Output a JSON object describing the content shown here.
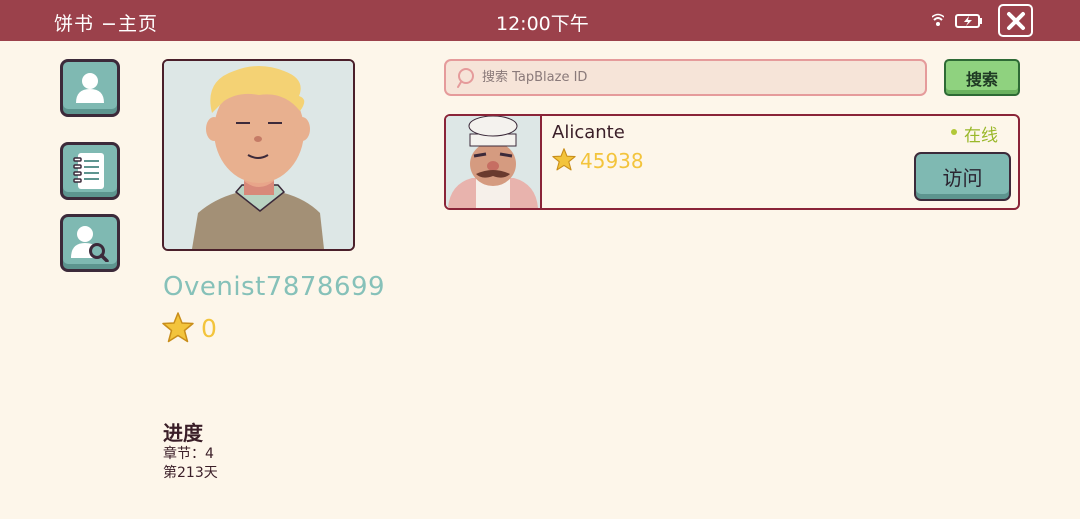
{
  "header": {
    "app_title": "饼书  −主页",
    "time": "12:00下午",
    "icons": [
      "wifi-icon",
      "battery-charging-icon",
      "close-icon"
    ]
  },
  "sidebar": {
    "items": [
      {
        "name": "profile",
        "icon": "user-icon"
      },
      {
        "name": "notebook",
        "icon": "notebook-icon"
      },
      {
        "name": "find-friend",
        "icon": "user-search-icon"
      }
    ]
  },
  "profile": {
    "name": "Ovenist7878699",
    "stars": "0",
    "progress_title": "进度",
    "chapter": "章节：4",
    "day": "第213天"
  },
  "search": {
    "placeholder": "搜索 TapBlaze ID",
    "button_label": "搜索"
  },
  "friends": [
    {
      "name": "Alicante",
      "stars": "45938",
      "status": "在线",
      "visit_label": "访问"
    }
  ],
  "colors": {
    "header_bg": "#9b414b",
    "page_bg": "#fdf6ea",
    "teal_button": "#7fb9b2",
    "green_button": "#8fd27f",
    "star_gold": "#f3c43c",
    "online_green": "#9ab82a",
    "name_teal": "#86c1b9"
  }
}
